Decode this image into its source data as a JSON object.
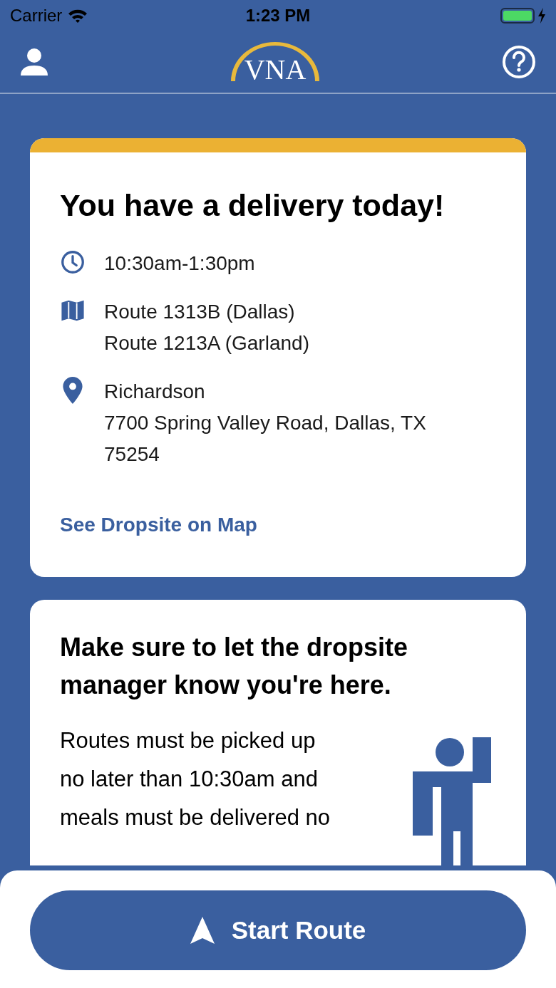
{
  "status_bar": {
    "carrier": "Carrier",
    "time": "1:23 PM",
    "charging": true
  },
  "header": {
    "logo": "VNA"
  },
  "delivery_card": {
    "title": "You have a delivery today!",
    "details": [
      {
        "kind": "time",
        "lines": [
          "10:30am-1:30pm"
        ]
      },
      {
        "kind": "route",
        "lines": [
          "Route 1313B (Dallas)",
          "Route 1213A (Garland)"
        ]
      },
      {
        "kind": "location",
        "lines": [
          "Richardson",
          "7700 Spring Valley Road, Dallas, TX",
          "75254"
        ]
      }
    ],
    "link": "See Dropsite on Map"
  },
  "notice_card": {
    "title_lines": [
      "Make sure to let the dropsite",
      "manager know you're here."
    ],
    "body_lines": [
      "Routes must be picked up",
      "no later than 10:30am and",
      "meals must be delivered no"
    ]
  },
  "start_button": {
    "label": "Start Route"
  }
}
